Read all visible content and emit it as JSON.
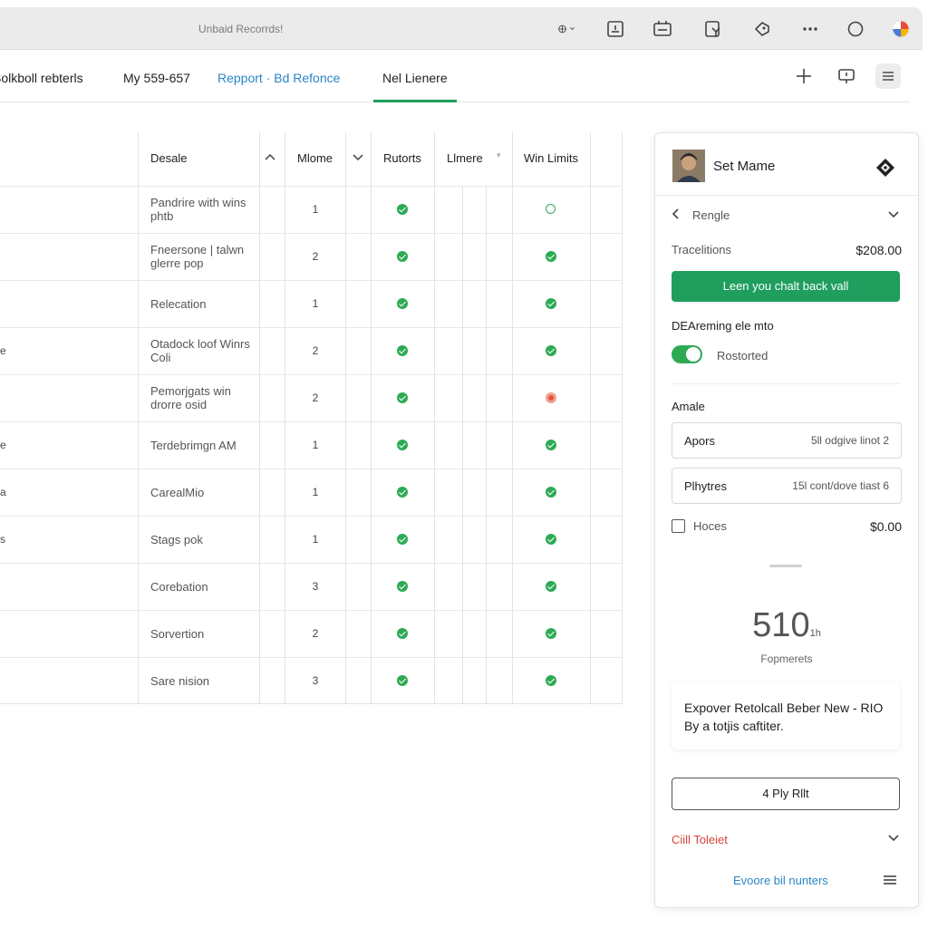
{
  "window": {
    "title": "Unbaid Recorrds!"
  },
  "tabs": [
    {
      "label": "Solkboll rebterls"
    },
    {
      "label": "My 559-657"
    },
    {
      "label": "Repport · Bd Refonce"
    },
    {
      "label": "Nel Lienere"
    }
  ],
  "table": {
    "headers": [
      "Desale",
      "Mlome",
      "Rutorts",
      "Llmere",
      "Win Limits"
    ],
    "rows": [
      {
        "desc": "Pandrire with wins phtb",
        "num": "1",
        "check": "ok",
        "limit": "outline"
      },
      {
        "desc": "Fneersone | talwn glerre pop",
        "num": "2",
        "check": "ok",
        "limit": "ok"
      },
      {
        "desc": "Relecation",
        "num": "1",
        "check": "ok",
        "limit": "ok"
      },
      {
        "desc": "Otadock loof Winrs Coli",
        "num": "2",
        "check": "ok",
        "limit": "ok"
      },
      {
        "desc": "Pemorjgats win drorre osid",
        "num": "2",
        "check": "ok",
        "limit": "warn"
      },
      {
        "desc": "Terdebrimgn AM",
        "num": "1",
        "check": "ok",
        "limit": "ok"
      },
      {
        "desc": "CarealMio",
        "num": "1",
        "check": "ok",
        "limit": "ok"
      },
      {
        "desc": "Stags pok",
        "num": "1",
        "check": "ok",
        "limit": "ok"
      },
      {
        "desc": "Corebation",
        "num": "3",
        "check": "ok",
        "limit": "ok"
      },
      {
        "desc": "Sorvertion",
        "num": "2",
        "check": "ok",
        "limit": "ok"
      },
      {
        "desc": "Sare nision",
        "num": "3",
        "check": "ok",
        "limit": "ok"
      }
    ],
    "left_ticks": [
      "e",
      "e",
      "a",
      "s"
    ]
  },
  "panel": {
    "title": "Set Mame",
    "range_label": "Rengle",
    "transactions_label": "Tracelitions",
    "transactions_amount": "$208.00",
    "primary_button": "Leen you chalt back vall",
    "toggle_section": "DEAreming ele mto",
    "toggle_label": "Rostorted",
    "amale_section": "Amale",
    "field1_label": "Apors",
    "field1_value": "5ll odgive linot 2",
    "field2_label": "Plhytres",
    "field2_value": "15l cont/dove tiast 6",
    "checkbox_label": "Hoces",
    "checkbox_amount": "$0.00",
    "big_number": "510",
    "big_number_unit": "1h",
    "big_number_caption": "Fopmerets",
    "card_text": "Expover Retolcall Beber New - RIO By a totjis caftiter.",
    "outline_button": "4 Ply Rllt",
    "red_link": "Ciill Toleiet",
    "blue_link": "Evoore bil nunters"
  },
  "colors": {
    "accent_green": "#1f9e5e",
    "link_blue": "#2a86c7",
    "alert_red": "#d9443a"
  }
}
